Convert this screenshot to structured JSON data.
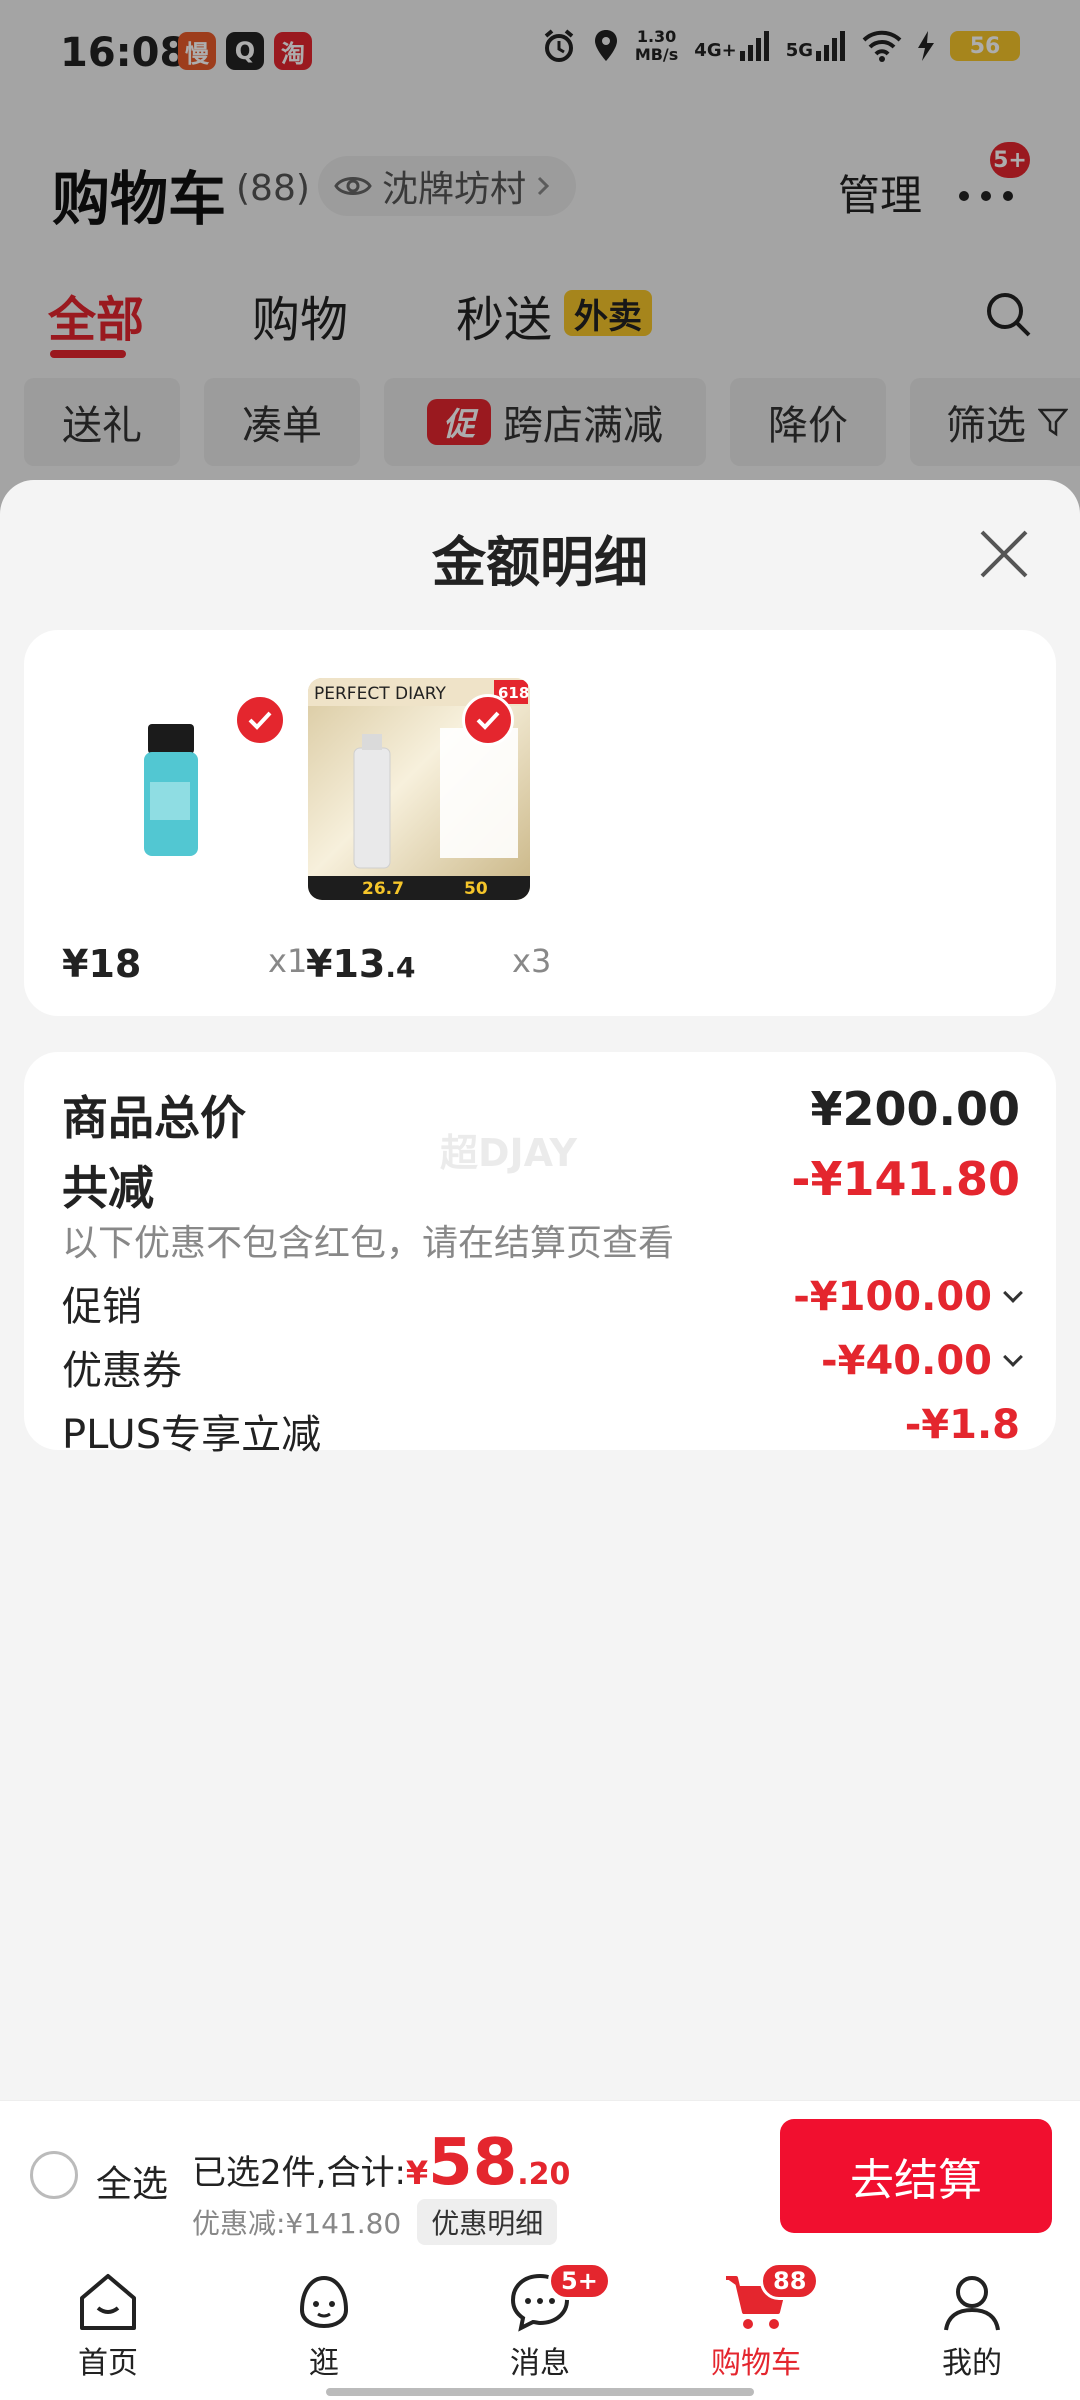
{
  "status": {
    "time": "16:08",
    "speed": "1.30",
    "speed_unit": "MB/s",
    "net1": "4G+",
    "net2": "5G",
    "battery": "56",
    "apps": [
      {
        "name": "慢",
        "color": "#e85a2a"
      },
      {
        "name": "Q",
        "color": "#222222"
      },
      {
        "name": "淘",
        "color": "#e4262e"
      }
    ]
  },
  "header": {
    "title": "购物车",
    "count": "(88)",
    "location": "沈牌坊村",
    "manage": "管理",
    "more_badge": "5+"
  },
  "tabs": [
    "全部",
    "购物",
    "秒送"
  ],
  "tab_badge": "外卖",
  "chips": [
    "送礼",
    "凑单",
    "跨店满减",
    "降价",
    "筛选"
  ],
  "chip_promo_icon": "促",
  "sheet": {
    "title": "金额明细",
    "products": [
      {
        "price_int": "¥18",
        "price_dec": "",
        "qty": "x1"
      },
      {
        "price_int": "¥13",
        "price_dec": ".4",
        "qty": "x3",
        "thumb_text": {
          "brand": "PERFECT DIARY",
          "tag": "618",
          "p1": "26.7",
          "p2": "50"
        }
      }
    ],
    "total_label": "商品总价",
    "total_value": "¥200.00",
    "reduce_label": "共减",
    "reduce_value": "-¥141.80",
    "reduce_note": "以下优惠不包含红包，请在结算页查看",
    "rows": [
      {
        "label": "促销",
        "value": "-¥100.00"
      },
      {
        "label": "优惠券",
        "value": "-¥40.00"
      },
      {
        "label": "PLUS专享立减",
        "value": "-¥1.8"
      }
    ],
    "watermark": "超DJAY"
  },
  "checkout": {
    "select_all": "全选",
    "summary": "已选2件,合计:",
    "yen": "¥",
    "total_int": "58",
    "total_dec": ".20",
    "discount": "优惠减:¥141.80",
    "detail_btn": "优惠明细",
    "button": "去结算"
  },
  "nav": [
    {
      "label": "首页",
      "icon": "home-icon"
    },
    {
      "label": "逛",
      "icon": "browse-icon"
    },
    {
      "label": "消息",
      "icon": "message-icon",
      "badge": "5+"
    },
    {
      "label": "购物车",
      "icon": "cart-icon",
      "badge": "88"
    },
    {
      "label": "我的",
      "icon": "profile-icon"
    }
  ],
  "colors": {
    "accent": "#e4262e",
    "checkout": "#f10f2f",
    "badge_yellow": "#f5c52a"
  }
}
